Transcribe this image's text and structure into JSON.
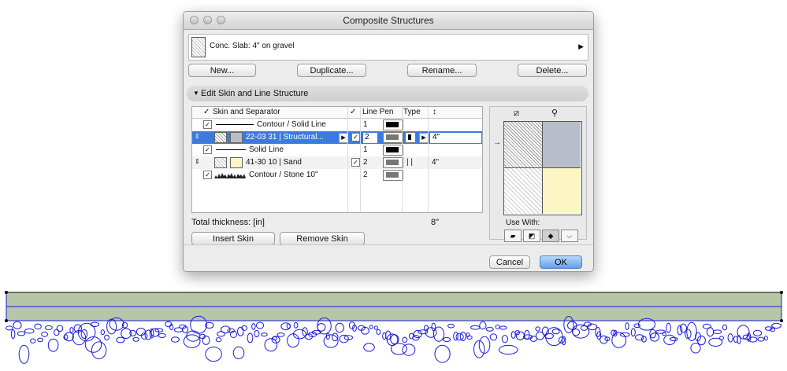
{
  "window": {
    "title": "Composite Structures"
  },
  "selector": {
    "label": "Conc. Slab: 4\" on gravel"
  },
  "buttons": {
    "new": "New...",
    "duplicate": "Duplicate...",
    "rename": "Rename...",
    "delete": "Delete..."
  },
  "section": {
    "title": "Edit Skin and Line Structure"
  },
  "table": {
    "headers": {
      "check": "✓",
      "skin": "Skin and Separator",
      "vis": "✓",
      "pen": "Line Pen",
      "type": "Type",
      "thick": "↕"
    },
    "rows": [
      {
        "checked": "✓",
        "name": "Contour /  Solid Line",
        "pen": "1",
        "thickness": ""
      },
      {
        "checked": "",
        "name": "22-03 31 | Structural...",
        "vis": "✓",
        "pen": "2",
        "thickness": "4\""
      },
      {
        "checked": "✓",
        "name": "Solid Line",
        "pen": "1",
        "thickness": ""
      },
      {
        "checked": "",
        "name": "41-30 10 | Sand",
        "vis": "✓",
        "pen": "2",
        "type": "| |",
        "thickness": "4\""
      },
      {
        "checked": "✓",
        "name": "Contour /  Stone 10\"",
        "pen": "2",
        "thickness": ""
      }
    ]
  },
  "total": {
    "label": "Total thickness: [in]",
    "value": "8\""
  },
  "skin_buttons": {
    "insert": "Insert Skin",
    "remove": "Remove Skin"
  },
  "preview": {
    "use_with": "Use With:"
  },
  "footer": {
    "cancel": "Cancel",
    "ok": "OK"
  },
  "colors": {
    "selection": "#3b7be0",
    "slab_fill": "#b5c7a7",
    "slab_line": "#1a1adb",
    "sand": "#fbf6c4",
    "concrete": "#b8bec9"
  }
}
